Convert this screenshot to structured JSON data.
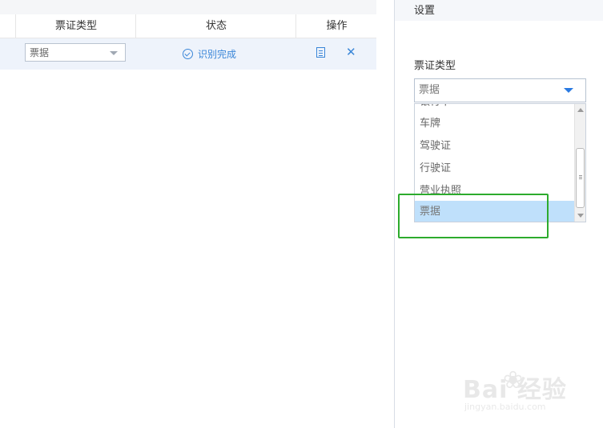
{
  "table": {
    "headers": [
      "票证类型",
      "状态",
      "操作"
    ],
    "row": {
      "type_value": "票据",
      "status_text": "识别完成"
    }
  },
  "settings": {
    "title": "设置",
    "field_label": "票证类型",
    "selected_value": "票据",
    "options": [
      "银行卡",
      "车牌",
      "驾驶证",
      "行驶证",
      "营业执照",
      "票据"
    ],
    "highlighted_option": "票据"
  },
  "watermark": {
    "brand": "Bai  经验",
    "site": "jingyan.baidu.com"
  },
  "colors": {
    "accent": "#3a86d8",
    "selection": "#bfe0fb",
    "annotation": "#2dab2d"
  },
  "icons": {
    "status": "check-circle-icon",
    "detail": "document-icon",
    "delete": "close-icon",
    "dropdown": "caret-down-icon"
  }
}
